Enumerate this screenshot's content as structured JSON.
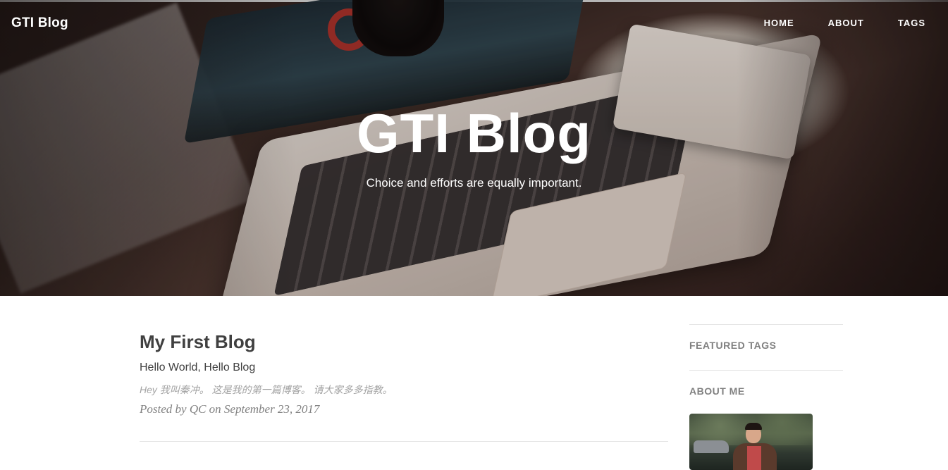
{
  "nav": {
    "brand": "GTI Blog",
    "links": [
      {
        "label": "HOME"
      },
      {
        "label": "ABOUT"
      },
      {
        "label": "TAGS"
      }
    ]
  },
  "hero": {
    "title": "GTI Blog",
    "subtitle": "Choice and efforts are equally important."
  },
  "posts": [
    {
      "title": "My First Blog",
      "subtitle": "Hello World, Hello Blog",
      "excerpt": "Hey 我叫秦冲。 这是我的第一篇博客。 请大家多多指教。",
      "meta": "Posted by QC on September 23, 2017"
    }
  ],
  "sidebar": {
    "featured_tags_heading": "FEATURED TAGS",
    "about_heading": "ABOUT ME"
  },
  "colors": {
    "text": "#404040",
    "muted": "#808080",
    "excerpt": "#a3a3a3",
    "divider": "#e6e6e6",
    "nav_text": "#ffffff"
  }
}
